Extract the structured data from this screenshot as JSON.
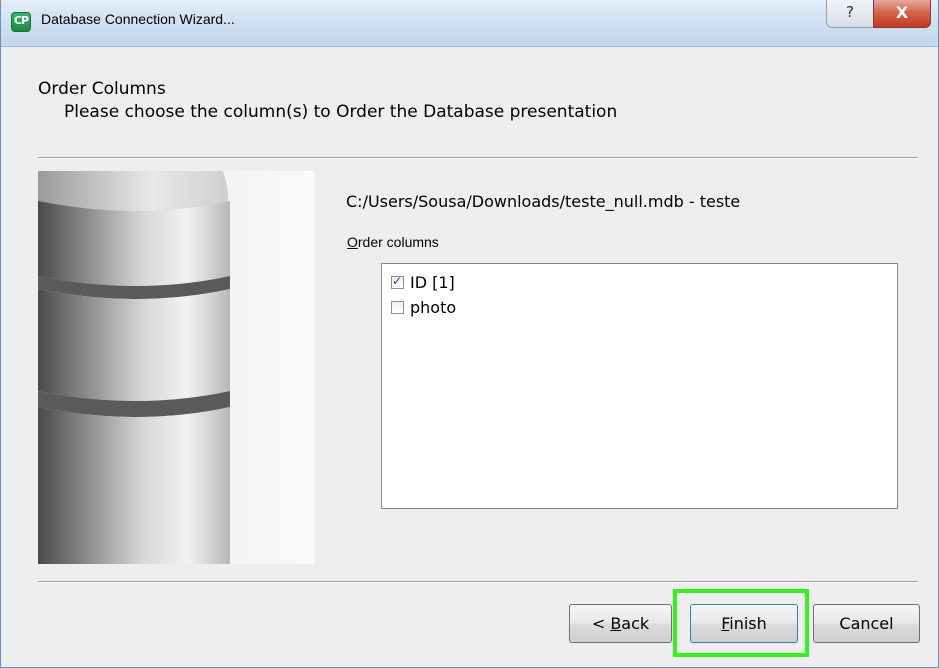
{
  "window": {
    "title": "Database Connection Wizard...",
    "app_icon_text": "CP",
    "help_button": "?",
    "close_button": "X"
  },
  "header": {
    "title": "Order Columns",
    "subtitle": "Please choose the column(s) to Order the Database presentation"
  },
  "content": {
    "source_path": "C:/Users/Sousa/Downloads/teste_null.mdb - teste",
    "order_label_mnemonic": "O",
    "order_label_rest": "rder columns",
    "columns": [
      {
        "label": "ID [1]",
        "checked": true
      },
      {
        "label": "photo",
        "checked": false
      }
    ]
  },
  "buttons": {
    "back_prefix": "< ",
    "back_mnemonic": "B",
    "back_rest": "ack",
    "finish_mnemonic": "F",
    "finish_rest": "inish",
    "cancel": "Cancel"
  },
  "colors": {
    "highlight": "#36f020",
    "close_button": "#c2371f",
    "app_icon": "#1c8a45"
  },
  "icons": [
    "app-icon",
    "help-icon",
    "close-icon",
    "database-icon",
    "checkbox-icon"
  ]
}
